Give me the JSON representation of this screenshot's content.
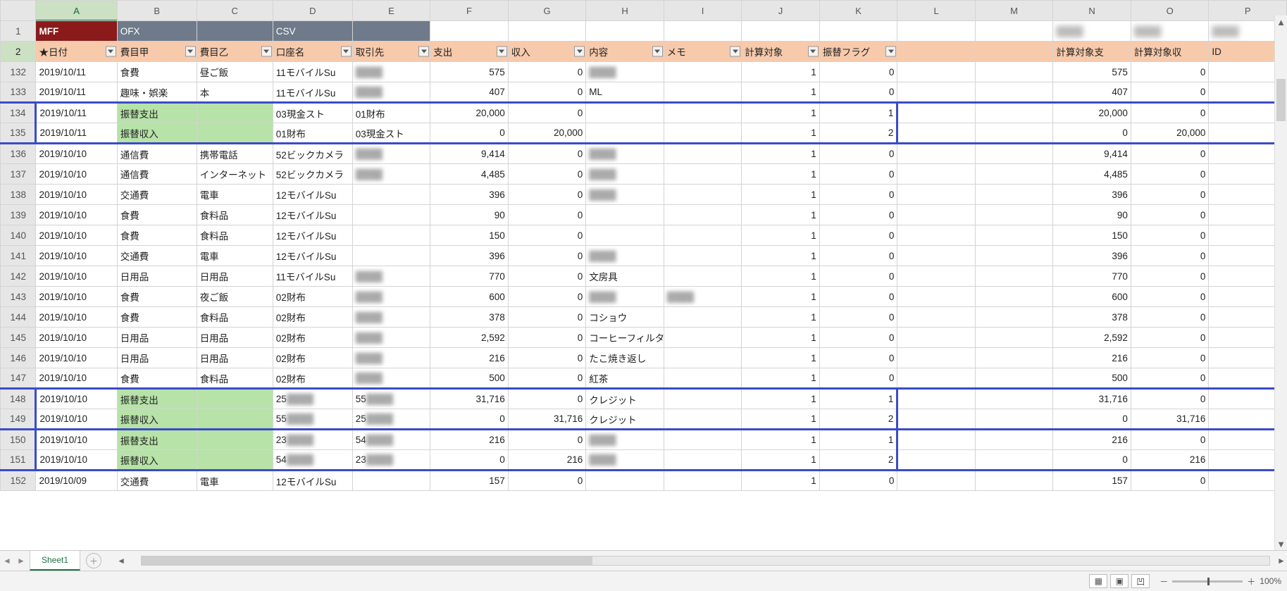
{
  "columns": [
    "A",
    "B",
    "C",
    "D",
    "E",
    "F",
    "G",
    "H",
    "I",
    "J",
    "K",
    "L",
    "M",
    "N",
    "O",
    "P"
  ],
  "active_column": "A",
  "active_row": "2",
  "row1": {
    "A": "MFF",
    "B": "OFX",
    "D": "CSV",
    "N": "",
    "O": "",
    "P": ""
  },
  "headers": {
    "A": "★日付",
    "B": "費目甲",
    "C": "費目乙",
    "D": "口座名",
    "E": "取引先",
    "F": "支出",
    "G": "収入",
    "H": "内容",
    "I": "メモ",
    "J": "計算対象",
    "K": "振替フラグ",
    "N": "計算対象支",
    "O": "計算対象収",
    "P": "ID"
  },
  "rows": [
    {
      "n": 132,
      "A": "2019/10/11",
      "B": "食費",
      "C": "昼ご飯",
      "D": "11モバイルSu",
      "E": "",
      "F": "575",
      "G": "0",
      "H": "",
      "J": "1",
      "K": "0",
      "N": "575",
      "O": "0",
      "blur": [
        "E",
        "H"
      ]
    },
    {
      "n": 133,
      "A": "2019/10/11",
      "B": "趣味・娯楽",
      "C": "本",
      "D": "11モバイルSu",
      "E": "",
      "F": "407",
      "G": "0",
      "H": "ML",
      "J": "1",
      "K": "0",
      "N": "407",
      "O": "0",
      "blur": [
        "E"
      ]
    },
    {
      "n": 134,
      "A": "2019/10/11",
      "B": "振替支出",
      "C": "",
      "D": "03現金スト",
      "E": "01財布",
      "F": "20,000",
      "G": "0",
      "H": "",
      "J": "1",
      "K": "1",
      "N": "20,000",
      "O": "0",
      "green": [
        "B",
        "C"
      ],
      "bluetop": true
    },
    {
      "n": 135,
      "A": "2019/10/11",
      "B": "振替収入",
      "C": "",
      "D": "01財布",
      "E": "03現金スト",
      "F": "0",
      "G": "20,000",
      "H": "",
      "J": "1",
      "K": "2",
      "N": "0",
      "O": "20,000",
      "green": [
        "B",
        "C"
      ],
      "bluebottom": true
    },
    {
      "n": 136,
      "A": "2019/10/10",
      "B": "通信費",
      "C": "携帯電話",
      "D": "52ビックカメラ",
      "E": "",
      "F": "9,414",
      "G": "0",
      "H": "",
      "J": "1",
      "K": "0",
      "N": "9,414",
      "O": "0",
      "blur": [
        "E",
        "H"
      ]
    },
    {
      "n": 137,
      "A": "2019/10/10",
      "B": "通信費",
      "C": "インターネット",
      "D": "52ビックカメラ",
      "E": "",
      "F": "4,485",
      "G": "0",
      "H": "",
      "J": "1",
      "K": "0",
      "N": "4,485",
      "O": "0",
      "blur": [
        "E",
        "H"
      ]
    },
    {
      "n": 138,
      "A": "2019/10/10",
      "B": "交通費",
      "C": "電車",
      "D": "12モバイルSu",
      "E": "",
      "F": "396",
      "G": "0",
      "H": "",
      "J": "1",
      "K": "0",
      "N": "396",
      "O": "0",
      "blur": [
        "H"
      ]
    },
    {
      "n": 139,
      "A": "2019/10/10",
      "B": "食費",
      "C": "食料品",
      "D": "12モバイルSu",
      "E": "",
      "F": "90",
      "G": "0",
      "H": "",
      "J": "1",
      "K": "0",
      "N": "90",
      "O": "0"
    },
    {
      "n": 140,
      "A": "2019/10/10",
      "B": "食費",
      "C": "食料品",
      "D": "12モバイルSu",
      "E": "",
      "F": "150",
      "G": "0",
      "H": "",
      "J": "1",
      "K": "0",
      "N": "150",
      "O": "0"
    },
    {
      "n": 141,
      "A": "2019/10/10",
      "B": "交通費",
      "C": "電車",
      "D": "12モバイルSu",
      "E": "",
      "F": "396",
      "G": "0",
      "H": "",
      "J": "1",
      "K": "0",
      "N": "396",
      "O": "0",
      "blur": [
        "H"
      ]
    },
    {
      "n": 142,
      "A": "2019/10/10",
      "B": "日用品",
      "C": "日用品",
      "D": "11モバイルSu",
      "E": "",
      "F": "770",
      "G": "0",
      "H": "文房具",
      "J": "1",
      "K": "0",
      "N": "770",
      "O": "0",
      "blur": [
        "E"
      ]
    },
    {
      "n": 143,
      "A": "2019/10/10",
      "B": "食費",
      "C": "夜ご飯",
      "D": "02財布",
      "E": "",
      "F": "600",
      "G": "0",
      "H": "",
      "I": "",
      "J": "1",
      "K": "0",
      "N": "600",
      "O": "0",
      "blur": [
        "E",
        "H",
        "I"
      ]
    },
    {
      "n": 144,
      "A": "2019/10/10",
      "B": "食費",
      "C": "食料品",
      "D": "02財布",
      "E": "",
      "F": "378",
      "G": "0",
      "H": "コショウ",
      "J": "1",
      "K": "0",
      "N": "378",
      "O": "0",
      "blur": [
        "E"
      ]
    },
    {
      "n": 145,
      "A": "2019/10/10",
      "B": "日用品",
      "C": "日用品",
      "D": "02財布",
      "E": "",
      "F": "2,592",
      "G": "0",
      "H": "コーヒーフィルタ",
      "J": "1",
      "K": "0",
      "N": "2,592",
      "O": "0",
      "blur": [
        "E"
      ]
    },
    {
      "n": 146,
      "A": "2019/10/10",
      "B": "日用品",
      "C": "日用品",
      "D": "02財布",
      "E": "",
      "F": "216",
      "G": "0",
      "H": "たこ焼き返し",
      "J": "1",
      "K": "0",
      "N": "216",
      "O": "0",
      "blur": [
        "E"
      ]
    },
    {
      "n": 147,
      "A": "2019/10/10",
      "B": "食費",
      "C": "食料品",
      "D": "02財布",
      "E": "",
      "F": "500",
      "G": "0",
      "H": "紅茶",
      "J": "1",
      "K": "0",
      "N": "500",
      "O": "0",
      "blur": [
        "E"
      ]
    },
    {
      "n": 148,
      "A": "2019/10/10",
      "B": "振替支出",
      "C": "",
      "D": "25",
      "E": "55",
      "F": "31,716",
      "G": "0",
      "H": "クレジット",
      "J": "1",
      "K": "1",
      "N": "31,716",
      "O": "0",
      "green": [
        "B",
        "C"
      ],
      "bluetop": true,
      "blur": [
        "D",
        "E"
      ],
      "blurPartial": true
    },
    {
      "n": 149,
      "A": "2019/10/10",
      "B": "振替収入",
      "C": "",
      "D": "55",
      "E": "25",
      "F": "0",
      "G": "31,716",
      "H": "クレジット",
      "J": "1",
      "K": "2",
      "N": "0",
      "O": "31,716",
      "green": [
        "B",
        "C"
      ],
      "bluebottom": true,
      "blur": [
        "D",
        "E"
      ],
      "blurPartial": true
    },
    {
      "n": 150,
      "A": "2019/10/10",
      "B": "振替支出",
      "C": "",
      "D": "23",
      "E": "54",
      "F": "216",
      "G": "0",
      "H": "",
      "J": "1",
      "K": "1",
      "N": "216",
      "O": "0",
      "green": [
        "B",
        "C"
      ],
      "bluetop": true,
      "blur": [
        "D",
        "E",
        "H"
      ],
      "blurPartial": true
    },
    {
      "n": 151,
      "A": "2019/10/10",
      "B": "振替収入",
      "C": "",
      "D": "54",
      "E": "23",
      "F": "0",
      "G": "216",
      "H": "",
      "J": "1",
      "K": "2",
      "N": "0",
      "O": "216",
      "green": [
        "B",
        "C"
      ],
      "bluebottom": true,
      "blur": [
        "D",
        "E",
        "H"
      ],
      "blurPartial": true
    },
    {
      "n": 152,
      "A": "2019/10/09",
      "B": "交通費",
      "C": "電車",
      "D": "12モバイルSu",
      "E": "",
      "F": "157",
      "G": "0",
      "H": "",
      "J": "1",
      "K": "0",
      "N": "157",
      "O": "0"
    }
  ],
  "numeric_cols": [
    "F",
    "G",
    "J",
    "K",
    "N",
    "O"
  ],
  "sheet_tab": "Sheet1",
  "zoom_label": "100%",
  "row1_blur": [
    "N",
    "O",
    "P"
  ]
}
